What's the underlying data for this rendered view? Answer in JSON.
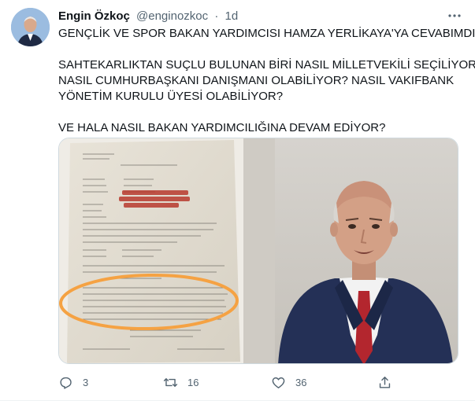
{
  "user": {
    "name": "Engin Özkoç",
    "handle": "@enginozkoc",
    "separator": "·",
    "time": "1d"
  },
  "tweet": {
    "lines": [
      "GENÇLİK VE SPOR BAKAN YARDIMCISI HAMZA YERLİKAYA'YA CEVABIMDIR!",
      "SAHTEKARLIKTAN SUÇLU BULUNAN BİRİ NASIL MİLLETVEKİLİ SEÇİLİYOR?",
      "NASIL CUMHURBAŞKANI DANIŞMANI OLABİLİYOR? NASIL VAKIFBANK",
      "YÖNETİM KURULU ÜYESİ OLABİLİYOR?",
      "VE HALA NASIL BAKAN YARDIMCILIĞINA DEVAM EDİYOR?"
    ]
  },
  "actions": {
    "reply_count": "3",
    "retweet_count": "16",
    "like_count": "36"
  },
  "icons": {
    "more": "more-dots-icon",
    "reply": "reply-icon",
    "retweet": "retweet-icon",
    "like": "heart-icon",
    "share": "share-icon"
  },
  "colors": {
    "text": "#0f1419",
    "secondary": "#536471",
    "highlight_circle": "#f5a243",
    "redaction": "#c0392b"
  }
}
